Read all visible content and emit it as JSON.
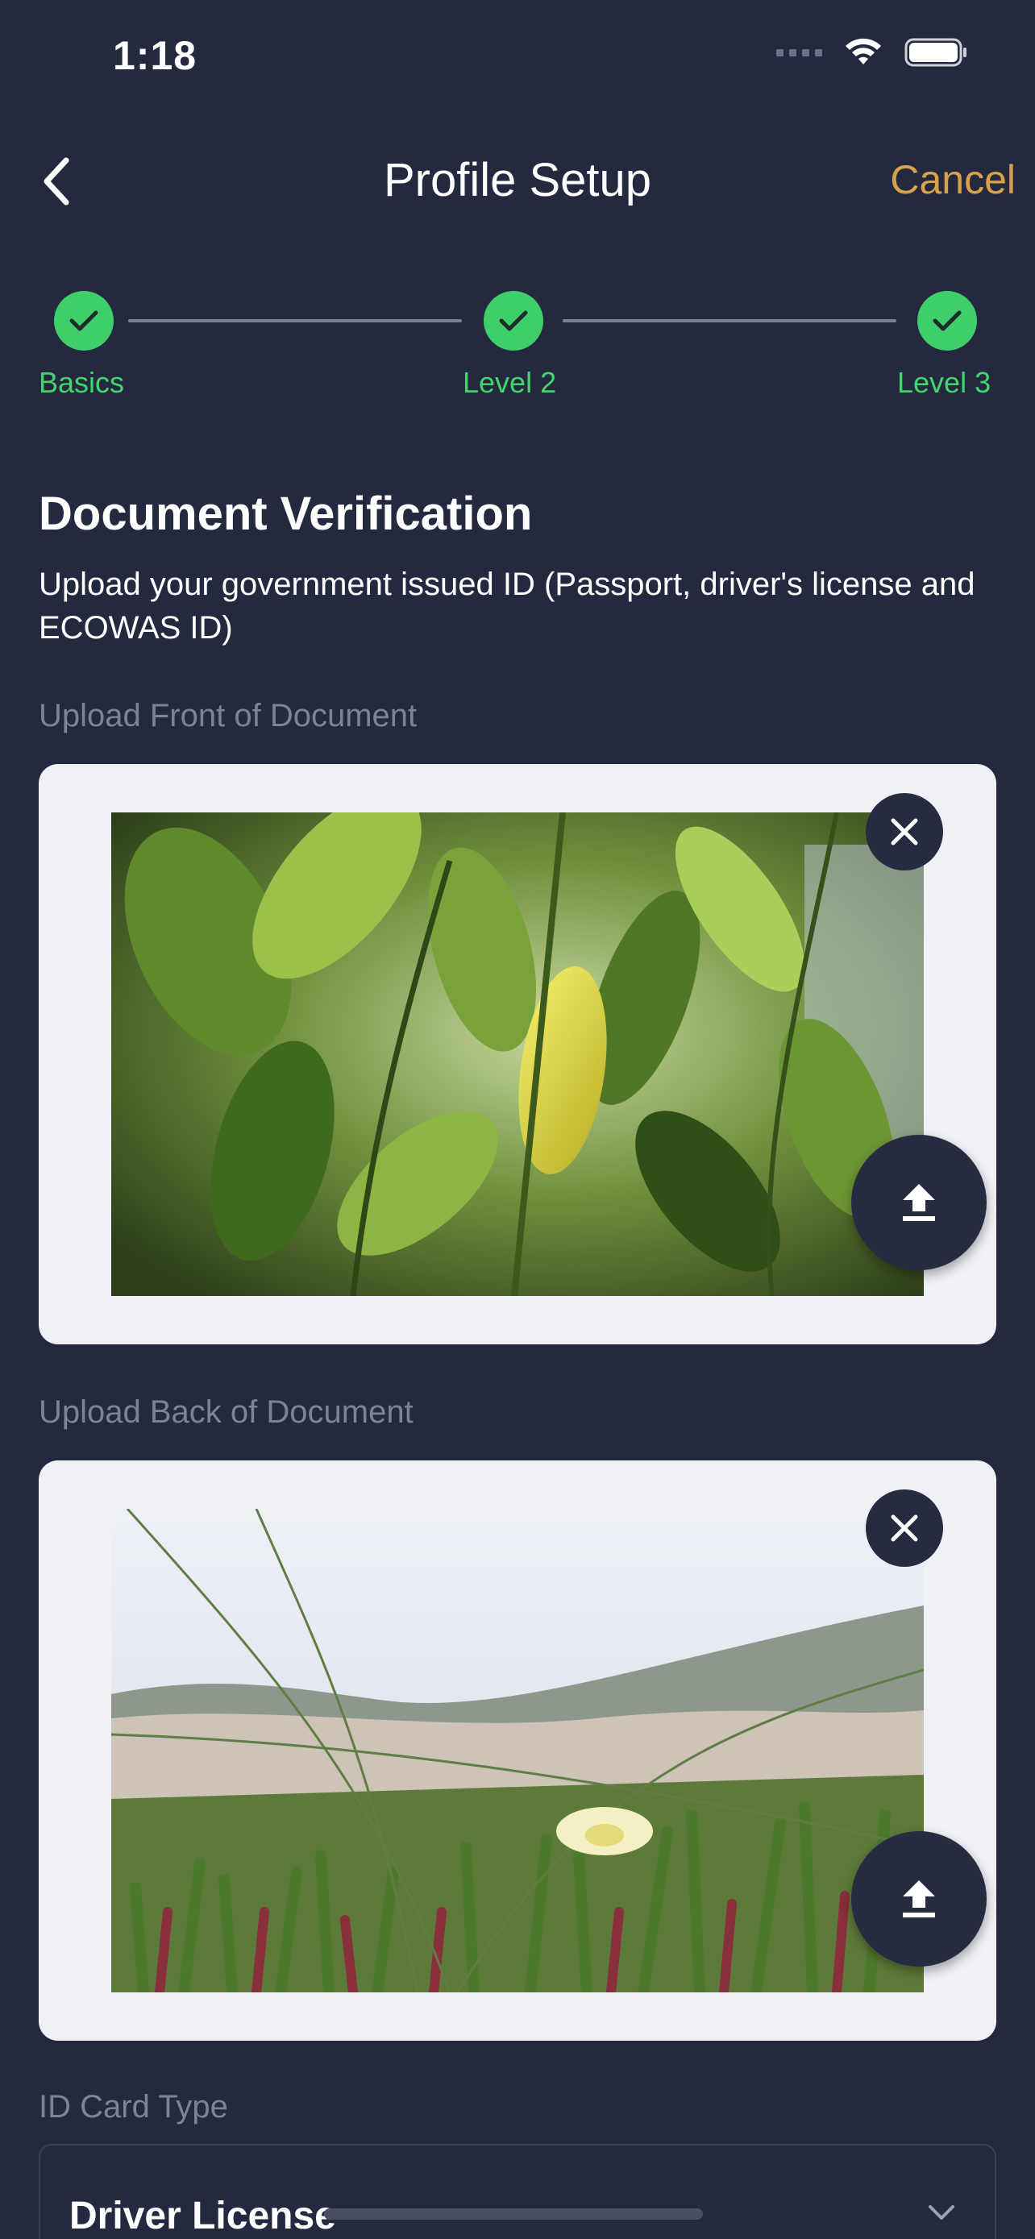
{
  "status_bar": {
    "time": "1:18",
    "icons": [
      "cellular-icon",
      "wifi-icon",
      "battery-icon"
    ]
  },
  "nav": {
    "title": "Profile Setup",
    "cancel_label": "Cancel",
    "back_icon": "chevron-left-icon"
  },
  "stepper": {
    "steps": [
      {
        "label": "Basics",
        "state": "complete"
      },
      {
        "label": "Level 2",
        "state": "complete"
      },
      {
        "label": "Level 3",
        "state": "complete"
      }
    ]
  },
  "document": {
    "title": "Document Verification",
    "description": "Upload your government issued ID (Passport, driver's license and ECOWAS ID)",
    "front_label": "Upload Front of Document",
    "back_label": "Upload Back of Document"
  },
  "id_type": {
    "label": "ID Card Type",
    "value": "Driver License"
  },
  "colors": {
    "background": "#242940",
    "accent_cancel": "#d8a24a",
    "step_complete": "#3ecf6a",
    "card_background": "#eff1f7"
  }
}
